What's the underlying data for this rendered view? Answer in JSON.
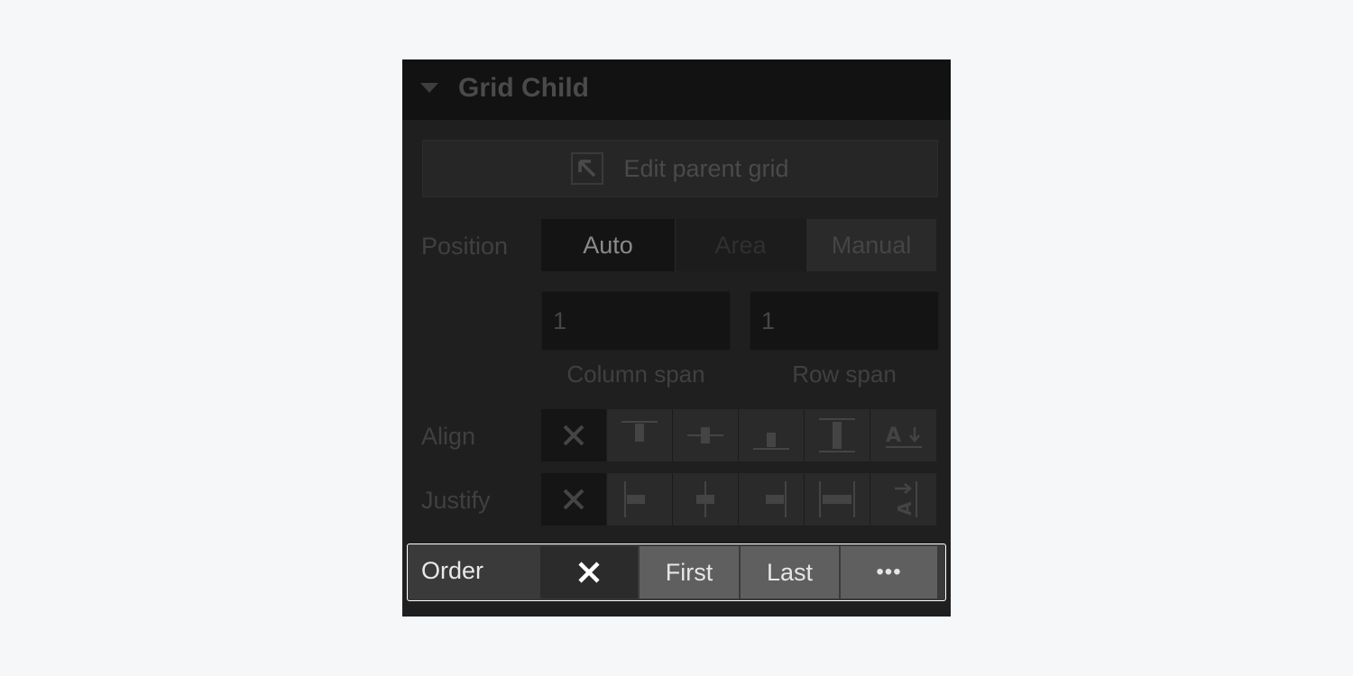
{
  "panel": {
    "title": "Grid Child",
    "edit_parent_label": "Edit parent grid"
  },
  "position": {
    "label": "Position",
    "options": [
      "Auto",
      "Area",
      "Manual"
    ],
    "selected": "Auto",
    "column_span_value": "1",
    "row_span_value": "1",
    "column_span_label": "Column span",
    "row_span_label": "Row span"
  },
  "align": {
    "label": "Align",
    "icons": [
      "none-x-icon",
      "align-start-icon",
      "align-center-icon",
      "align-end-icon",
      "align-stretch-icon",
      "align-baseline-icon"
    ]
  },
  "justify": {
    "label": "Justify",
    "icons": [
      "none-x-icon",
      "justify-start-icon",
      "justify-center-icon",
      "justify-end-icon",
      "justify-stretch-icon",
      "justify-baseline-icon"
    ]
  },
  "order": {
    "label": "Order",
    "first_label": "First",
    "last_label": "Last",
    "more_label": "•••"
  },
  "colors": {
    "panel_bg": "#1f1f1f",
    "header_bg": "#121212",
    "highlight_border": "#ffffff"
  }
}
